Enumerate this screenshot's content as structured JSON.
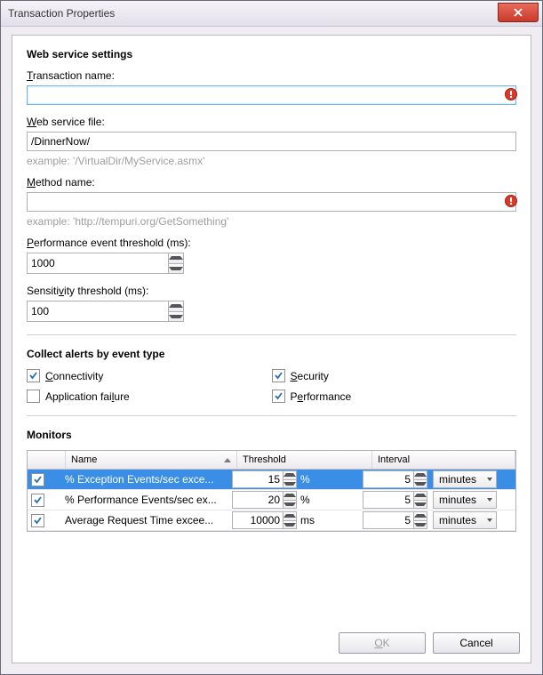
{
  "window": {
    "title": "Transaction Properties"
  },
  "section1": {
    "title": "Web service settings"
  },
  "txName": {
    "label_pre": "",
    "label_u": "T",
    "label_post": "ransaction name:",
    "value": "",
    "placeholder": ""
  },
  "wsFile": {
    "label_pre": "",
    "label_u": "W",
    "label_post": "eb service file:",
    "value": "/DinnerNow/",
    "hint": "example: '/VirtualDir/MyService.asmx'"
  },
  "method": {
    "label_pre": "",
    "label_u": "M",
    "label_post": "ethod name:",
    "value": "",
    "hint": "example: 'http://tempuri.org/GetSomething'"
  },
  "perf": {
    "label_pre": "",
    "label_u": "P",
    "label_post": "erformance event threshold (ms):",
    "value": "1000"
  },
  "sens": {
    "label_pre": "Sensiti",
    "label_u": "v",
    "label_post": "ity threshold (ms):",
    "value": "100"
  },
  "section2": {
    "title": "Collect alerts by event type"
  },
  "checks": {
    "connectivity": {
      "label": "Connectivity",
      "checked": true,
      "underline": "C"
    },
    "security": {
      "label": "Security",
      "checked": true,
      "underline": "S"
    },
    "appfail": {
      "label_pre": "Application fai",
      "label_u": "l",
      "label_post": "ure",
      "checked": false
    },
    "performance": {
      "label_pre": "P",
      "label_u": "e",
      "label_post": "rformance",
      "checked": true
    }
  },
  "section3": {
    "title": "Monitors"
  },
  "monitorHeaders": {
    "name": "Name",
    "threshold": "Threshold",
    "interval": "Interval"
  },
  "monitors": [
    {
      "name": "% Exception Events/sec exce...",
      "threshold": "15",
      "unit": "%",
      "interval": "5",
      "intervalUnit": "minutes",
      "checked": true,
      "selected": true
    },
    {
      "name": "% Performance Events/sec ex...",
      "threshold": "20",
      "unit": "%",
      "interval": "5",
      "intervalUnit": "minutes",
      "checked": true,
      "selected": false
    },
    {
      "name": "Average Request Time excee...",
      "threshold": "10000",
      "unit": "ms",
      "interval": "5",
      "intervalUnit": "minutes",
      "checked": true,
      "selected": false
    }
  ],
  "buttons": {
    "ok": "OK",
    "cancel": "Cancel"
  }
}
